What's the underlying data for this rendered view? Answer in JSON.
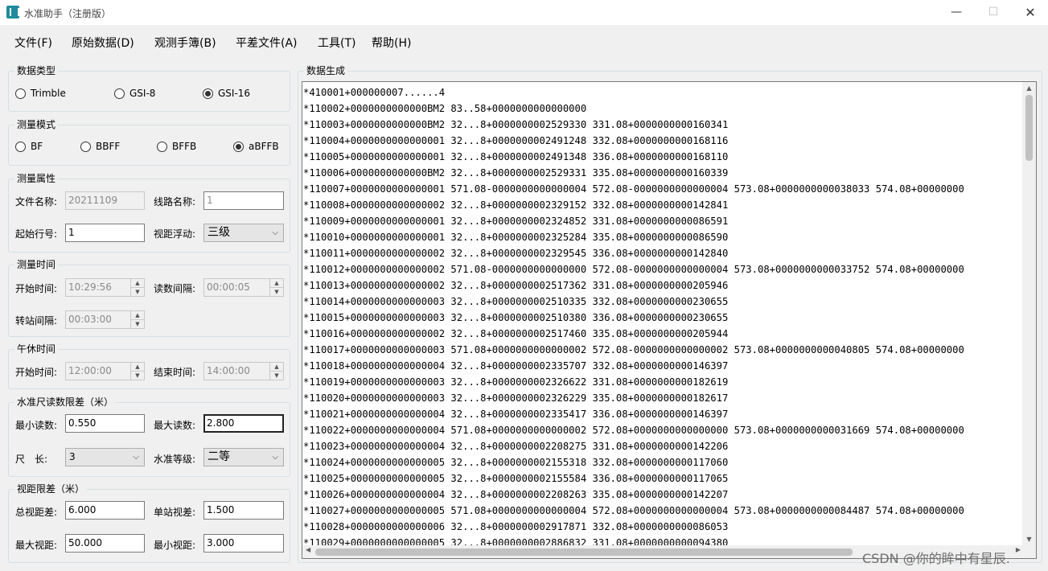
{
  "window": {
    "title": "水准助手（注册版）",
    "minimize": "—",
    "maximize": "☐",
    "close": "✕"
  },
  "menu": [
    "文件(F)",
    "原始数据(D)",
    "观测手簿(B)",
    "平差文件(A)",
    "工具(T)",
    "帮助(H)"
  ],
  "data_type": {
    "title": "数据类型",
    "options": [
      "Trimble",
      "GSI-8",
      "GSI-16"
    ],
    "selected": "GSI-16"
  },
  "measure_mode": {
    "title": "测量模式",
    "options": [
      "BF",
      "BBFF",
      "BFFB",
      "aBFFB"
    ],
    "selected": "aBFFB"
  },
  "measure_attr": {
    "title": "测量属性",
    "file_name_label": "文件名称:",
    "file_name_value": "20211109",
    "route_name_label": "线路名称:",
    "route_name_value": "1",
    "start_line_label": "起始行号:",
    "start_line_value": "1",
    "sight_float_label": "视距浮动:",
    "sight_float_value": "三级"
  },
  "measure_time": {
    "title": "测量时间",
    "start_label": "开始时间:",
    "start_value": "10:29:56",
    "read_interval_label": "读数间隔:",
    "read_interval_value": "00:00:05",
    "station_interval_label": "转站间隔:",
    "station_interval_value": "00:03:00"
  },
  "lunch_break": {
    "title": "午休时间",
    "start_label": "开始时间:",
    "start_value": "12:00:00",
    "end_label": "结束时间:",
    "end_value": "14:00:00"
  },
  "rod_limit": {
    "title": "水准尺读数限差（米）",
    "min_label": "最小读数:",
    "min_value": "0.550",
    "max_label": "最大读数:",
    "max_value": "2.800",
    "length_label": "尺　长:",
    "length_value": "3",
    "grade_label": "水准等级:",
    "grade_value": "二等"
  },
  "sight_limit": {
    "title": "视距限差（米）",
    "total_diff_label": "总视距差:",
    "total_diff_value": "6.000",
    "station_diff_label": "单站视差:",
    "station_diff_value": "1.500",
    "max_label": "最大视距:",
    "max_value": "50.000",
    "min_label": "最小视距:",
    "min_value": "3.000"
  },
  "data_gen": {
    "title": "数据生成",
    "lines": [
      "*410001+000000007......4",
      "*110002+0000000000000BM2 83..58+0000000000000000",
      "*110003+0000000000000BM2 32...8+0000000002529330 331.08+0000000000160341",
      "*110004+0000000000000001 32...8+0000000002491248 332.08+0000000000168116",
      "*110005+0000000000000001 32...8+0000000002491348 336.08+0000000000168110",
      "*110006+0000000000000BM2 32...8+0000000002529331 335.08+0000000000160339",
      "*110007+0000000000000001 571.08-0000000000000004 572.08-0000000000000004 573.08+0000000000038033 574.08+00000000",
      "*110008+0000000000000002 32...8+0000000002329152 332.08+0000000000142841",
      "*110009+0000000000000001 32...8+0000000002324852 331.08+0000000000086591",
      "*110010+0000000000000001 32...8+0000000002325284 335.08+0000000000086590",
      "*110011+0000000000000002 32...8+0000000002329545 336.08+0000000000142840",
      "*110012+0000000000000002 571.08-0000000000000000 572.08-0000000000000004 573.08+0000000000033752 574.08+00000000",
      "*110013+0000000000000002 32...8+0000000002517362 331.08+0000000000205946",
      "*110014+0000000000000003 32...8+0000000002510335 332.08+0000000000230655",
      "*110015+0000000000000003 32...8+0000000002510380 336.08+0000000000230655",
      "*110016+0000000000000002 32...8+0000000002517460 335.08+0000000000205944",
      "*110017+0000000000000003 571.08+0000000000000002 572.08-0000000000000002 573.08+0000000000040805 574.08+00000000",
      "*110018+0000000000000004 32...8+0000000002335707 332.08+0000000000146397",
      "*110019+0000000000000003 32...8+0000000002326622 331.08+0000000000182619",
      "*110020+0000000000000003 32...8+0000000002326229 335.08+0000000000182617",
      "*110021+0000000000000004 32...8+0000000002335417 336.08+0000000000146397",
      "*110022+0000000000000004 571.08+0000000000000002 572.08+0000000000000000 573.08+0000000000031669 574.08+00000000",
      "*110023+0000000000000004 32...8+0000000002208275 331.08+0000000000142206",
      "*110024+0000000000000005 32...8+0000000002155318 332.08+0000000000117060",
      "*110025+0000000000000005 32...8+0000000002155584 336.08+0000000000117065",
      "*110026+0000000000000004 32...8+0000000002208263 335.08+0000000000142207",
      "*110027+0000000000000005 571.08+0000000000000004 572.08+0000000000000004 573.08+0000000000084487 574.08+00000000",
      "*110028+0000000000000006 32...8+0000000002917871 332.08+0000000000086053",
      "*110029+0000000000000005 32...8+0000000002886832 331.08+0000000000094380"
    ]
  },
  "watermark": "CSDN @你的眸中有星辰."
}
